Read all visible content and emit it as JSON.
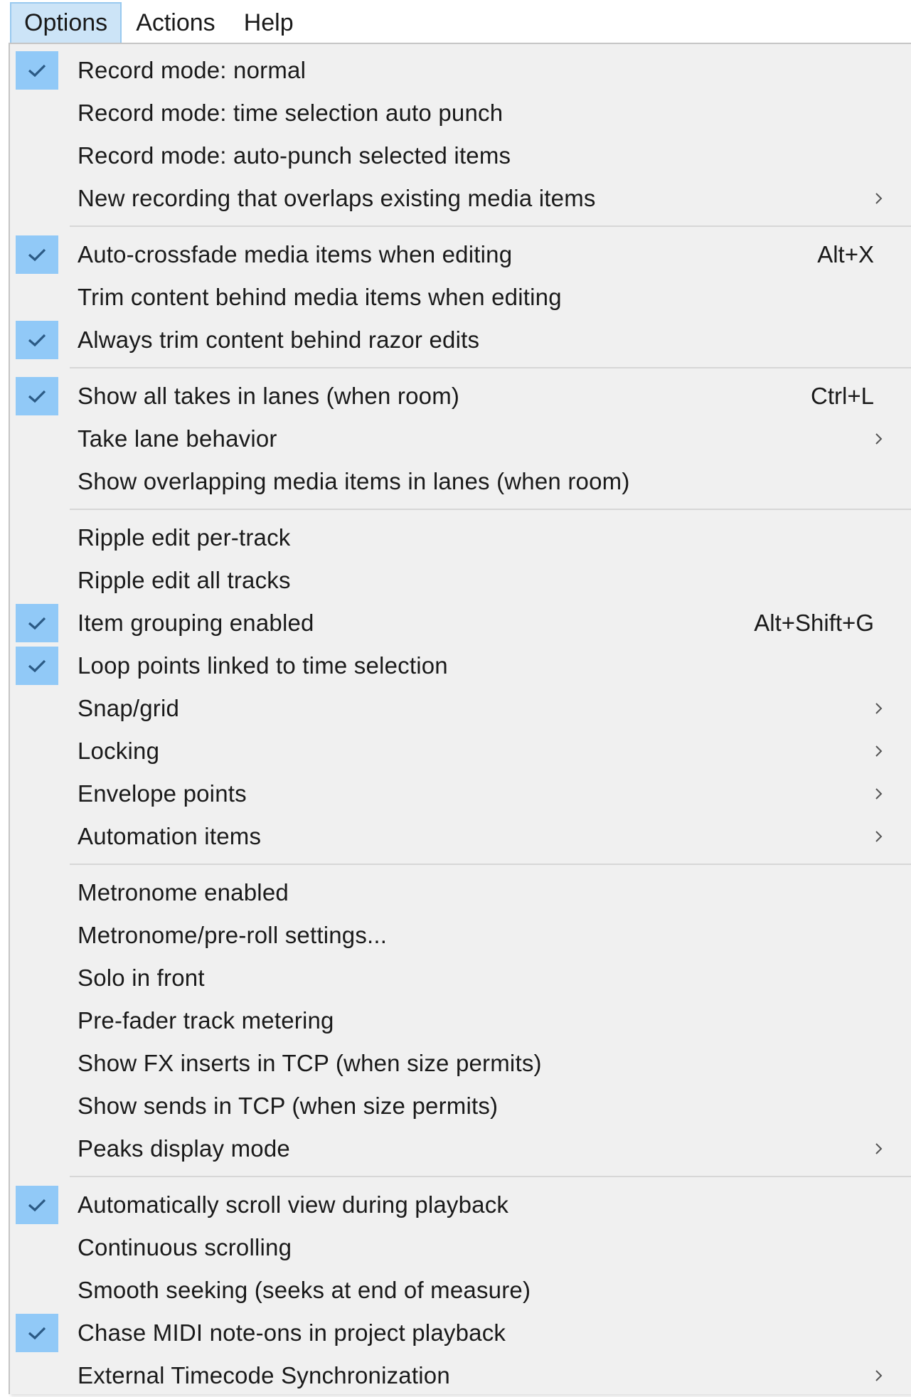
{
  "menubar": {
    "items": [
      {
        "label": "Options",
        "active": true
      },
      {
        "label": "Actions",
        "active": false
      },
      {
        "label": "Help",
        "active": false
      }
    ]
  },
  "menu": {
    "groups": [
      [
        {
          "label": "Record mode: normal",
          "checked": true,
          "shortcut": "",
          "submenu": false
        },
        {
          "label": "Record mode: time selection auto punch",
          "checked": false,
          "shortcut": "",
          "submenu": false
        },
        {
          "label": "Record mode: auto-punch selected items",
          "checked": false,
          "shortcut": "",
          "submenu": false
        },
        {
          "label": "New recording that overlaps existing media items",
          "checked": false,
          "shortcut": "",
          "submenu": true
        }
      ],
      [
        {
          "label": "Auto-crossfade media items when editing",
          "checked": true,
          "shortcut": "Alt+X",
          "submenu": false
        },
        {
          "label": "Trim content behind media items when editing",
          "checked": false,
          "shortcut": "",
          "submenu": false
        },
        {
          "label": "Always trim content behind razor edits",
          "checked": true,
          "shortcut": "",
          "submenu": false
        }
      ],
      [
        {
          "label": "Show all takes in lanes (when room)",
          "checked": true,
          "shortcut": "Ctrl+L",
          "submenu": false
        },
        {
          "label": "Take lane behavior",
          "checked": false,
          "shortcut": "",
          "submenu": true
        },
        {
          "label": "Show overlapping media items in lanes (when room)",
          "checked": false,
          "shortcut": "",
          "submenu": false
        }
      ],
      [
        {
          "label": "Ripple edit per-track",
          "checked": false,
          "shortcut": "",
          "submenu": false
        },
        {
          "label": "Ripple edit all tracks",
          "checked": false,
          "shortcut": "",
          "submenu": false
        },
        {
          "label": "Item grouping enabled",
          "checked": true,
          "shortcut": "Alt+Shift+G",
          "submenu": false
        },
        {
          "label": "Loop points linked to time selection",
          "checked": true,
          "shortcut": "",
          "submenu": false
        },
        {
          "label": "Snap/grid",
          "checked": false,
          "shortcut": "",
          "submenu": true
        },
        {
          "label": "Locking",
          "checked": false,
          "shortcut": "",
          "submenu": true
        },
        {
          "label": "Envelope points",
          "checked": false,
          "shortcut": "",
          "submenu": true
        },
        {
          "label": "Automation items",
          "checked": false,
          "shortcut": "",
          "submenu": true
        }
      ],
      [
        {
          "label": "Metronome enabled",
          "checked": false,
          "shortcut": "",
          "submenu": false
        },
        {
          "label": "Metronome/pre-roll settings...",
          "checked": false,
          "shortcut": "",
          "submenu": false
        },
        {
          "label": "Solo in front",
          "checked": false,
          "shortcut": "",
          "submenu": false
        },
        {
          "label": "Pre-fader track metering",
          "checked": false,
          "shortcut": "",
          "submenu": false
        },
        {
          "label": "Show FX inserts in TCP (when size permits)",
          "checked": false,
          "shortcut": "",
          "submenu": false
        },
        {
          "label": "Show sends in TCP (when size permits)",
          "checked": false,
          "shortcut": "",
          "submenu": false
        },
        {
          "label": "Peaks display mode",
          "checked": false,
          "shortcut": "",
          "submenu": true
        }
      ],
      [
        {
          "label": "Automatically scroll view during playback",
          "checked": true,
          "shortcut": "",
          "submenu": false
        },
        {
          "label": "Continuous scrolling",
          "checked": false,
          "shortcut": "",
          "submenu": false
        },
        {
          "label": "Smooth seeking (seeks at end of measure)",
          "checked": false,
          "shortcut": "",
          "submenu": false
        },
        {
          "label": "Chase MIDI note-ons in project playback",
          "checked": true,
          "shortcut": "",
          "submenu": false
        },
        {
          "label": "External Timecode Synchronization",
          "checked": false,
          "shortcut": "",
          "submenu": true
        }
      ]
    ]
  },
  "colors": {
    "check_highlight": "#91c9f7",
    "menu_background": "#f0f0f0",
    "active_menubar": "#cce4f7"
  },
  "icons": {
    "check": "checkmark-icon",
    "submenu": "chevron-right-icon"
  }
}
